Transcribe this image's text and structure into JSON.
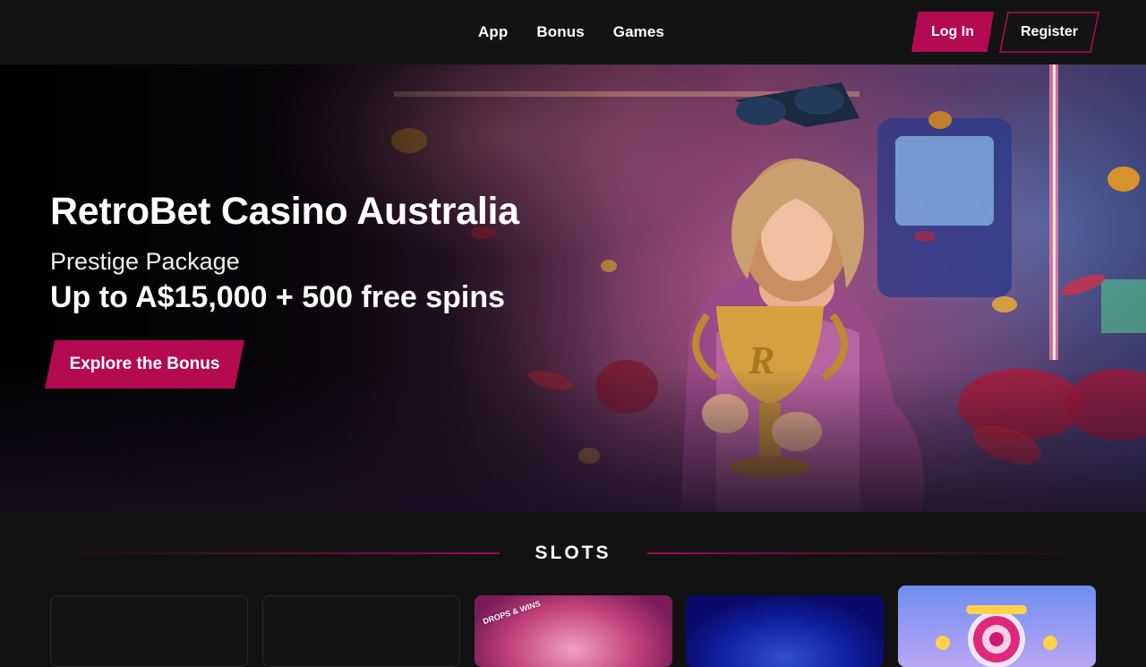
{
  "nav": {
    "items": [
      {
        "label": "App"
      },
      {
        "label": "Bonus"
      },
      {
        "label": "Games"
      }
    ]
  },
  "auth": {
    "login_label": "Log In",
    "register_label": "Register"
  },
  "hero": {
    "title": "RetroBet Casino Australia",
    "subtitle": "Prestige Package",
    "offer": "Up to A$15,000 + 500 free spins",
    "cta_label": "Explore the Bonus"
  },
  "slots": {
    "heading": "SLOTS",
    "cards": [
      {
        "type": "placeholder"
      },
      {
        "type": "placeholder"
      },
      {
        "type": "game",
        "badge": "DROPS & WINS"
      },
      {
        "type": "game"
      },
      {
        "type": "game"
      }
    ]
  },
  "colors": {
    "accent": "#b30a52",
    "background": "#121212",
    "header": "#131313"
  }
}
